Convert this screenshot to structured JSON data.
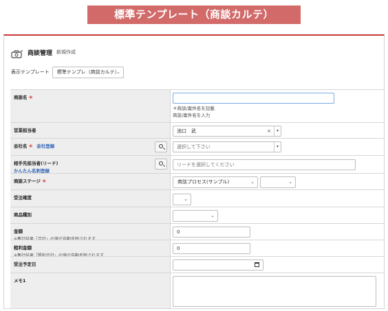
{
  "banner": {
    "title": "標準テンプレート（商談カルテ）"
  },
  "header": {
    "title": "商談管理",
    "subtitle": "新規作成"
  },
  "template": {
    "label": "表示テンプレート",
    "selected": "標準テンプレ（商談カルテ）"
  },
  "form": {
    "deal_name": {
      "label": "商談名",
      "required_mark": "＊",
      "hint1": "＊商談/案件名を記載",
      "hint2": "商談/案件名を入力",
      "value": ""
    },
    "sales_rep": {
      "label": "営業担当者",
      "value": "池口　武",
      "clear": "×"
    },
    "company": {
      "label": "会社名",
      "required_mark": "＊",
      "link": "会社登録",
      "placeholder": "選択して下さい"
    },
    "contact": {
      "label": "相手先担当者(リード)",
      "link": "かんたん名刺登録",
      "placeholder": "リードを選択してください"
    },
    "stage": {
      "label": "商談ステージ",
      "required_mark": "＊",
      "value": "商談プロセス(サンプル)",
      "value2": ""
    },
    "accuracy": {
      "label": "受注確度",
      "value": ""
    },
    "product_type": {
      "label": "商品種別",
      "value": ""
    },
    "amount": {
      "label": "金額",
      "note": "※集計結果「合計」の値が自動反映されます",
      "value": "0"
    },
    "gross_amount": {
      "label": "粗利金額",
      "note": "※集計結果「粗利合計」の値が自動反映されます",
      "value": "0"
    },
    "expected_date": {
      "label": "受注予定日",
      "value": ""
    },
    "memo": {
      "label": "メモ1",
      "value": ""
    }
  }
}
